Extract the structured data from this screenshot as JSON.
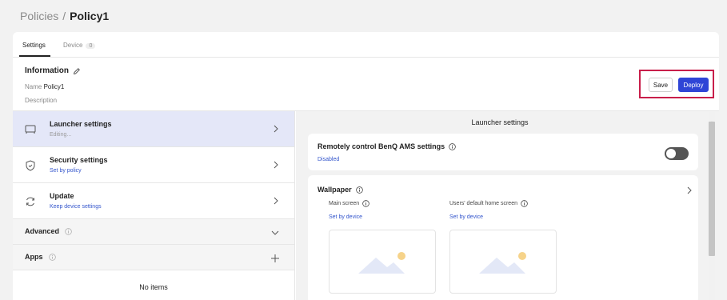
{
  "breadcrumb": {
    "parent": "Policies",
    "separator": "/",
    "current": "Policy1"
  },
  "tabs": [
    {
      "label": "Settings"
    },
    {
      "label": "Device",
      "count": "0"
    }
  ],
  "information": {
    "title": "Information",
    "name_label": "Name",
    "name_value": "Policy1",
    "description_label": "Description"
  },
  "actions": {
    "save": "Save",
    "deploy": "Deploy",
    "highlight_color": "#c81e4a",
    "deploy_color": "#2f45d6"
  },
  "menu": [
    {
      "title": "Launcher settings",
      "subtitle": "Editing...",
      "icon": "monitor-icon"
    },
    {
      "title": "Security settings",
      "subtitle": "Set by policy",
      "icon": "shield-icon"
    },
    {
      "title": "Update",
      "subtitle": "Keep device settings",
      "icon": "sync-icon"
    }
  ],
  "sections": {
    "advanced": "Advanced",
    "apps": "Apps",
    "no_items": "No items"
  },
  "detail": {
    "header": "Launcher settings",
    "remote": {
      "title": "Remotely control BenQ AMS settings",
      "status": "Disabled",
      "enabled": false
    },
    "wallpaper": {
      "title": "Wallpaper",
      "main_label": "Main screen",
      "main_value": "Set by device",
      "users_label": "Users' default home screen",
      "users_value": "Set by device"
    }
  },
  "colors": {
    "link": "#3355cc",
    "active_row": "#e4e7f8",
    "toggle_off": "#555555"
  }
}
